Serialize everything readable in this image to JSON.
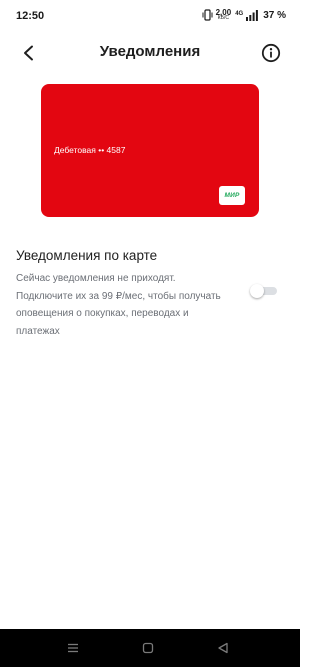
{
  "status_bar": {
    "time": "12:50",
    "speed_value": "2,00",
    "speed_unit": "КБ/С",
    "network_type": "4G",
    "battery": "37 %",
    "icons": [
      "vibrate-icon",
      "signal-icon"
    ]
  },
  "header": {
    "title": "Уведомления",
    "back_icon": "chevron-left-icon",
    "info_icon": "info-circle-icon"
  },
  "card": {
    "name": "Дебетовая •• 4587",
    "payment_system": "МИР",
    "color": "#e30611"
  },
  "notifications": {
    "title": "Уведомления по карте",
    "description": "Сейчас уведомления не приходят. Подключите их за 99 ₽/мес, чтобы получать оповещения о покупках, переводах и платежах",
    "toggle_on": false
  },
  "nav_bar": {
    "icons": [
      "menu-icon",
      "home-icon",
      "back-triangle-icon"
    ]
  }
}
